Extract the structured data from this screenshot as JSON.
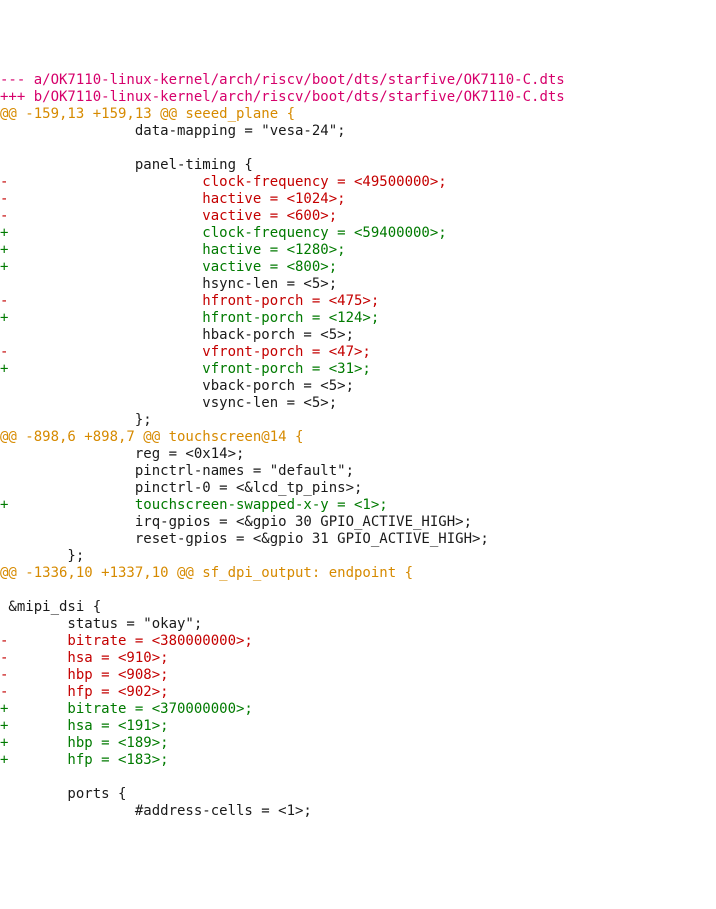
{
  "patch": {
    "file_from": "--- a/OK7110-linux-kernel/arch/riscv/boot/dts/starfive/OK7110-C.dts",
    "file_to": "+++ b/OK7110-linux-kernel/arch/riscv/boot/dts/starfive/OK7110-C.dts",
    "hunks": [
      {
        "header": "@@ -159,13 +159,13 @@ seeed_plane {",
        "lines": [
          {
            "type": "ctx",
            "text": "                data-mapping = \"vesa-24\";"
          },
          {
            "type": "ctx",
            "text": ""
          },
          {
            "type": "ctx",
            "text": "                panel-timing {"
          },
          {
            "type": "del",
            "text": "-                       clock-frequency = <49500000>;"
          },
          {
            "type": "del",
            "text": "-                       hactive = <1024>;"
          },
          {
            "type": "del",
            "text": "-                       vactive = <600>;"
          },
          {
            "type": "add",
            "text": "+                       clock-frequency = <59400000>;"
          },
          {
            "type": "add",
            "text": "+                       hactive = <1280>;"
          },
          {
            "type": "add",
            "text": "+                       vactive = <800>;"
          },
          {
            "type": "ctx",
            "text": "                        hsync-len = <5>;"
          },
          {
            "type": "del",
            "text": "-                       hfront-porch = <475>;"
          },
          {
            "type": "add",
            "text": "+                       hfront-porch = <124>;"
          },
          {
            "type": "ctx",
            "text": "                        hback-porch = <5>;"
          },
          {
            "type": "del",
            "text": "-                       vfront-porch = <47>;"
          },
          {
            "type": "add",
            "text": "+                       vfront-porch = <31>;"
          },
          {
            "type": "ctx",
            "text": "                        vback-porch = <5>;"
          },
          {
            "type": "ctx",
            "text": "                        vsync-len = <5>;"
          },
          {
            "type": "ctx",
            "text": "                };"
          }
        ]
      },
      {
        "header": "@@ -898,6 +898,7 @@ touchscreen@14 {",
        "lines": [
          {
            "type": "ctx",
            "text": "                reg = <0x14>;"
          },
          {
            "type": "ctx",
            "text": "                pinctrl-names = \"default\";"
          },
          {
            "type": "ctx",
            "text": "                pinctrl-0 = <&lcd_tp_pins>;"
          },
          {
            "type": "add",
            "text": "+               touchscreen-swapped-x-y = <1>;"
          },
          {
            "type": "ctx",
            "text": "                irq-gpios = <&gpio 30 GPIO_ACTIVE_HIGH>;"
          },
          {
            "type": "ctx",
            "text": "                reset-gpios = <&gpio 31 GPIO_ACTIVE_HIGH>;"
          },
          {
            "type": "ctx",
            "text": "        };"
          }
        ]
      },
      {
        "header": "@@ -1336,10 +1337,10 @@ sf_dpi_output: endpoint {",
        "lines": [
          {
            "type": "ctx",
            "text": ""
          },
          {
            "type": "ctx",
            "text": " &mipi_dsi {"
          },
          {
            "type": "ctx",
            "text": "        status = \"okay\";"
          },
          {
            "type": "del",
            "text": "-       bitrate = <380000000>;"
          },
          {
            "type": "del",
            "text": "-       hsa = <910>;"
          },
          {
            "type": "del",
            "text": "-       hbp = <908>;"
          },
          {
            "type": "del",
            "text": "-       hfp = <902>;"
          },
          {
            "type": "add",
            "text": "+       bitrate = <370000000>;"
          },
          {
            "type": "add",
            "text": "+       hsa = <191>;"
          },
          {
            "type": "add",
            "text": "+       hbp = <189>;"
          },
          {
            "type": "add",
            "text": "+       hfp = <183>;"
          },
          {
            "type": "ctx",
            "text": ""
          },
          {
            "type": "ctx",
            "text": "        ports {"
          },
          {
            "type": "ctx",
            "text": "                #address-cells = <1>;"
          }
        ]
      }
    ]
  }
}
